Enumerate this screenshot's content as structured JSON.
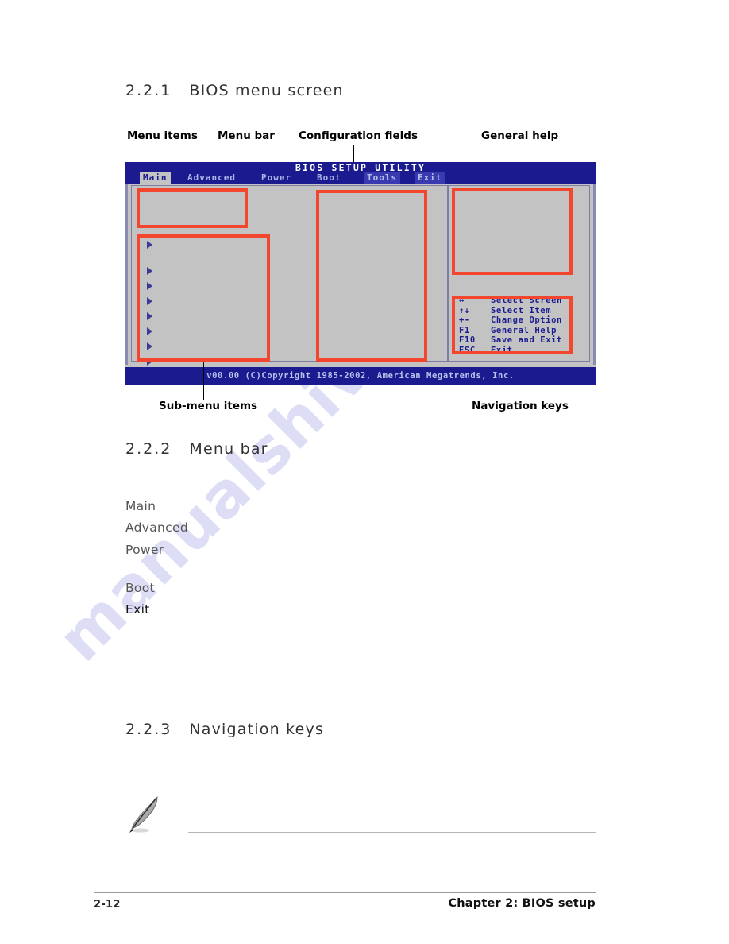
{
  "document": {
    "sections": [
      {
        "number": "2.2.1",
        "title": "BIOS menu screen"
      },
      {
        "number": "2.2.2",
        "title": "Menu bar"
      },
      {
        "number": "2.2.3",
        "title": "Navigation keys"
      }
    ],
    "footer": {
      "page_number": "2-12",
      "chapter": "Chapter 2: BIOS setup"
    },
    "watermark": "manualshive.com"
  },
  "callouts": {
    "menu_items": "Menu items",
    "menu_bar": "Menu bar",
    "configuration_fields": "Configuration fields",
    "general_help": "General help",
    "sub_menu_items": "Sub-menu items",
    "navigation_keys": "Navigation keys"
  },
  "bios": {
    "title": "BIOS SETUP UTILITY",
    "menu_bar": [
      {
        "label": "Main",
        "state": "selected"
      },
      {
        "label": "Advanced",
        "state": "normal"
      },
      {
        "label": "Power",
        "state": "normal"
      },
      {
        "label": "Boot",
        "state": "normal"
      },
      {
        "label": "Tools",
        "state": "shaded"
      },
      {
        "label": "Exit",
        "state": "shaded"
      }
    ],
    "sub_menu_arrow_count": 8,
    "navigation_keys": [
      {
        "key": "↔",
        "action": "Select Screen"
      },
      {
        "key": "↑↓",
        "action": "Select Item"
      },
      {
        "key": "+-",
        "action": "Change Option"
      },
      {
        "key": "F1",
        "action": "General Help"
      },
      {
        "key": "F10",
        "action": "Save and Exit"
      },
      {
        "key": "ESC",
        "action": "Exit"
      }
    ],
    "footer": "v00.00 (C)Copyright 1985-2002, American Megatrends, Inc."
  },
  "menu_bar_list": [
    {
      "label": "Main",
      "emphasis": "light"
    },
    {
      "label": "Advanced",
      "emphasis": "light"
    },
    {
      "label": "Power",
      "emphasis": "light"
    },
    {
      "label": "Boot",
      "emphasis": "light"
    },
    {
      "label": "Exit",
      "emphasis": "dark"
    }
  ],
  "colors": {
    "bios_blue": "#1b1b8f",
    "bios_gray": "#c3c3c3",
    "annotation_red": "#f2462e",
    "menu_text": "#a8b4e8"
  }
}
